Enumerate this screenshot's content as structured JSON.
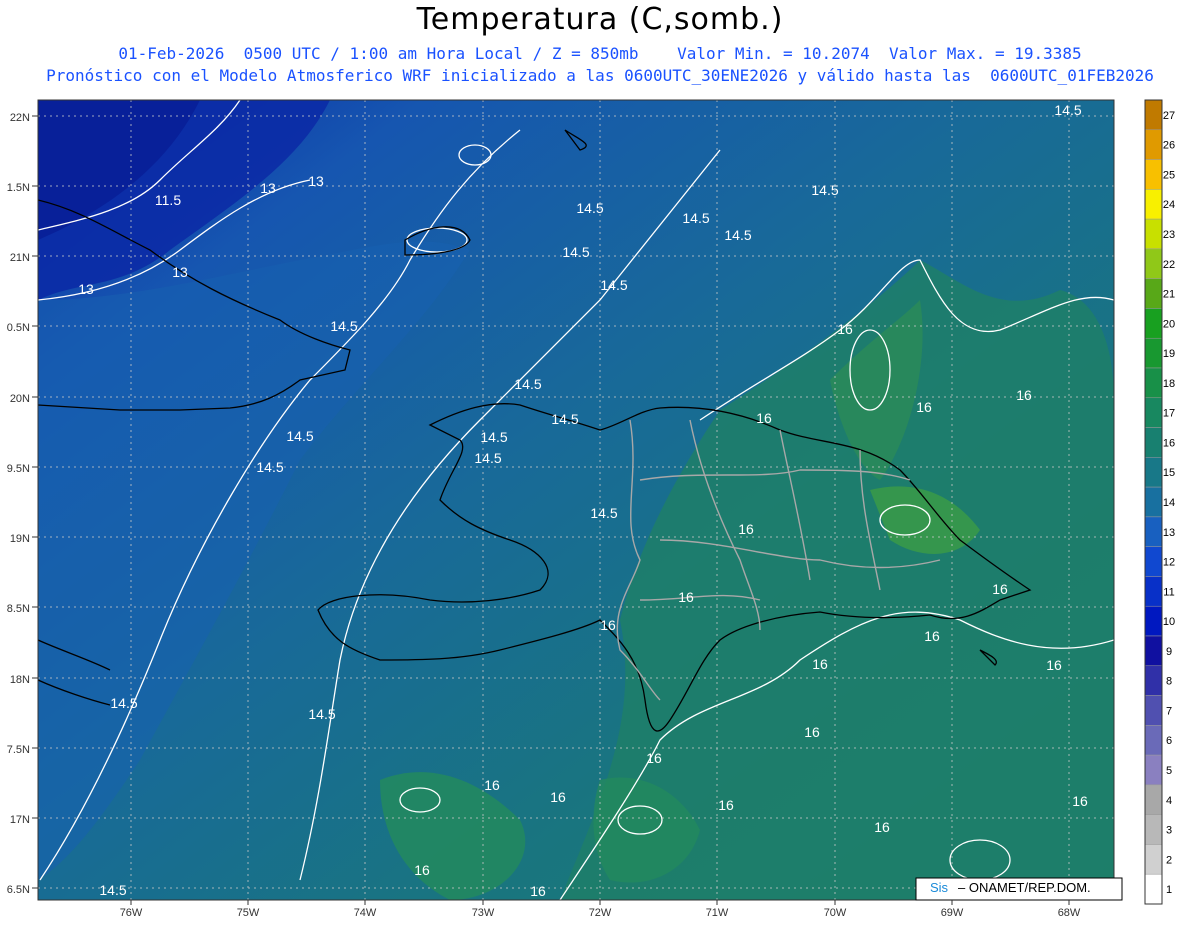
{
  "header": {
    "title": "Temperatura (C,somb.)",
    "line1": "01-Feb-2026  0500 UTC / 1:00 am Hora Local / Z = 850mb    Valor Min. = 10.2074  Valor Max. = 19.3385",
    "line2": "Pronóstico con el Modelo Atmosferico WRF inicializado a las 0600UTC_30ENE2026 y válido hasta las  0600UTC_01FEB2026"
  },
  "map": {
    "lat_labels": [
      "22N",
      "1.5N",
      "21N",
      "0.5N",
      "20N",
      "9.5N",
      "19N",
      "8.5N",
      "18N",
      "7.5N",
      "17N",
      "6.5N"
    ],
    "lon_labels": [
      "76W",
      "75W",
      "74W",
      "73W",
      "72W",
      "71W",
      "70W",
      "69W",
      "68W"
    ],
    "contour_labels": [
      "11.5",
      "13",
      "13",
      "13",
      "13",
      "14.5",
      "14.5",
      "14.5",
      "14.5",
      "14.5",
      "14.5",
      "14.5",
      "14.5",
      "14.5",
      "14.5",
      "14.5",
      "14.5",
      "14.5",
      "14.5",
      "14.5",
      "14.5",
      "14.5",
      "14.5",
      "16",
      "16",
      "16",
      "16",
      "16",
      "16",
      "16",
      "16",
      "16",
      "16",
      "16",
      "16",
      "16",
      "16",
      "16",
      "16",
      "16",
      "16",
      "16",
      "16"
    ],
    "credit_sis": "Sis",
    "credit_text": "– ONAMET/REP.DOM.",
    "colors": {
      "cold": "#0a2aa8",
      "mid": "#1a5aa8",
      "base": "#19717d",
      "warm": "#2a8a5a",
      "contour": "#ffffff",
      "coast": "#000000",
      "border": "#a8a8a8"
    }
  },
  "colorbar": {
    "labels": [
      "27",
      "26",
      "25",
      "24",
      "23",
      "22",
      "21",
      "20",
      "19",
      "18",
      "17",
      "16",
      "15",
      "14",
      "13",
      "12",
      "11",
      "10",
      "9",
      "8",
      "7",
      "6",
      "5",
      "4",
      "3",
      "2",
      "1"
    ],
    "colors": [
      "#c07a00",
      "#e09a00",
      "#f8c000",
      "#f8f000",
      "#c8e000",
      "#90c818",
      "#58a818",
      "#18a020",
      "#189830",
      "#189048",
      "#188860",
      "#188070",
      "#187888",
      "#1870a0",
      "#1860c0",
      "#1048d0",
      "#0830c8",
      "#0018c0",
      "#1010a0",
      "#3030a8",
      "#5050b0",
      "#6a6ab8",
      "#8a80c0",
      "#a8a8a8",
      "#b8b8b8",
      "#d0d0d0",
      "#ffffff"
    ]
  }
}
